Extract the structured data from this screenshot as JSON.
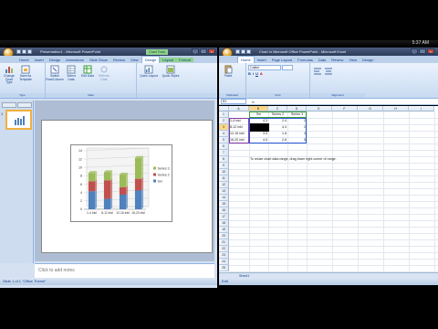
{
  "clock": "5:37 AM",
  "ppt": {
    "title": "Presentation1 - Microsoft PowerPoint",
    "context_label": "Chart Tools",
    "tabs": [
      "Home",
      "Insert",
      "Design",
      "Animations",
      "Slide Show",
      "Review",
      "View",
      "Design",
      "Layout",
      "Format"
    ],
    "active_tab_index": 7,
    "groups": [
      {
        "label": "Type",
        "buttons": [
          "Change Chart Type",
          "Save As Template"
        ]
      },
      {
        "label": "Data",
        "buttons": [
          "Switch Row/Column",
          "Select Data",
          "Edit Data",
          "Refresh Data"
        ]
      },
      {
        "label": "",
        "buttons": [
          "Quick Layout",
          "Quick Styles"
        ]
      }
    ],
    "notes_placeholder": "Click to add notes",
    "status": "Slide 1 of 1   \"Office Theme\"",
    "slide_number": "1"
  },
  "chart_data": {
    "type": "bar",
    "stacked": true,
    "categories": [
      "1-4 inkl",
      "8-12 inkl",
      "12-16 inkl",
      "16-20 inkl"
    ],
    "series": [
      {
        "name": "Ser",
        "values": [
          4.3,
          2.5,
          3.5,
          4.5
        ],
        "color": "#4f81bd"
      },
      {
        "name": "Series 2",
        "values": [
          2.4,
          4.4,
          1.8,
          2.8
        ],
        "color": "#c0504d"
      },
      {
        "name": "Series 3",
        "values": [
          2,
          2,
          3,
          5
        ],
        "color": "#9bbb59"
      }
    ],
    "ylim": [
      0,
      14
    ],
    "yticks": [
      "0",
      "2",
      "4",
      "6",
      "8",
      "10",
      "12",
      "14"
    ],
    "legend_position": "right",
    "grid": true
  },
  "excel": {
    "title": "Chart in Microsoft Office PowerPoint - Microsoft Excel",
    "tabs": [
      "Home",
      "Insert",
      "Page Layout",
      "Formulas",
      "Data",
      "Review",
      "View",
      "Design"
    ],
    "active_tab_index": 0,
    "groups": [
      {
        "label": "Clipboard",
        "buttons": [
          "Paste"
        ]
      },
      {
        "label": "Font",
        "buttons": [
          "Calibri"
        ]
      },
      {
        "label": "Alignment",
        "buttons": [
          ""
        ]
      }
    ],
    "namebox": "B3",
    "columns": [
      "A",
      "B",
      "C",
      "D",
      "E",
      "F",
      "G",
      "H",
      "I"
    ],
    "rows": [
      "1",
      "2",
      "3",
      "4",
      "5",
      "6",
      "7",
      "8",
      "9",
      "10",
      "11",
      "12",
      "13",
      "14",
      "15",
      "16",
      "17",
      "18",
      "19",
      "20",
      "21",
      "22",
      "23",
      "24",
      "25"
    ],
    "header_row": [
      "",
      "Ser",
      "Series 2",
      "Series 3"
    ],
    "data_rows": [
      [
        "1-4 inkl",
        "4.3",
        "2.4",
        "2"
      ],
      [
        "8-12 inkl",
        "2.5",
        "4.4",
        "2"
      ],
      [
        "12-16 inkl",
        "3.5",
        "1.8",
        "3"
      ],
      [
        "16-20 inkl",
        "4.5",
        "2.8",
        "5"
      ]
    ],
    "note": "To resize chart data range, drag lower right corner of range.",
    "sheet_tab": "Sheet1",
    "status": "Edit"
  }
}
